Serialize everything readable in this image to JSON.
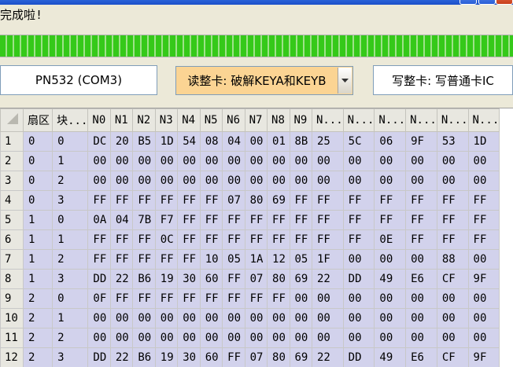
{
  "status_text": "完成啦!",
  "progress_percent": 100,
  "reader": {
    "label": "PN532 (COM3)"
  },
  "mode": {
    "selected": "读整卡: 破解KEYA和KEYB"
  },
  "write_button": {
    "label": "写整卡: 写普通卡IC"
  },
  "colors": {
    "progress": "#35c919",
    "combo_bg": "#fbd493",
    "cell_bg": "#d2d2ec"
  },
  "grid": {
    "columns": [
      "扇区",
      "块...",
      "N0",
      "N1",
      "N2",
      "N3",
      "N4",
      "N5",
      "N6",
      "N7",
      "N8",
      "N9",
      "N...",
      "N...",
      "N...",
      "N...",
      "N...",
      "N..."
    ],
    "rows": [
      {
        "n": "1",
        "cells": [
          "0",
          "0",
          "DC",
          "20",
          "B5",
          "1D",
          "54",
          "08",
          "04",
          "00",
          "01",
          "8B",
          "25",
          "5C",
          "06",
          "9F",
          "53",
          "1D"
        ]
      },
      {
        "n": "2",
        "cells": [
          "0",
          "1",
          "00",
          "00",
          "00",
          "00",
          "00",
          "00",
          "00",
          "00",
          "00",
          "00",
          "00",
          "00",
          "00",
          "00",
          "00",
          "00"
        ]
      },
      {
        "n": "3",
        "cells": [
          "0",
          "2",
          "00",
          "00",
          "00",
          "00",
          "00",
          "00",
          "00",
          "00",
          "00",
          "00",
          "00",
          "00",
          "00",
          "00",
          "00",
          "00"
        ]
      },
      {
        "n": "4",
        "cells": [
          "0",
          "3",
          "FF",
          "FF",
          "FF",
          "FF",
          "FF",
          "FF",
          "07",
          "80",
          "69",
          "FF",
          "FF",
          "FF",
          "FF",
          "FF",
          "FF",
          "FF"
        ]
      },
      {
        "n": "5",
        "cells": [
          "1",
          "0",
          "0A",
          "04",
          "7B",
          "F7",
          "FF",
          "FF",
          "FF",
          "FF",
          "FF",
          "FF",
          "FF",
          "FF",
          "FF",
          "FF",
          "FF",
          "FF"
        ]
      },
      {
        "n": "6",
        "cells": [
          "1",
          "1",
          "FF",
          "FF",
          "FF",
          "0C",
          "FF",
          "FF",
          "FF",
          "FF",
          "FF",
          "FF",
          "FF",
          "FF",
          "0E",
          "FF",
          "FF",
          "FF"
        ]
      },
      {
        "n": "7",
        "cells": [
          "1",
          "2",
          "FF",
          "FF",
          "FF",
          "FF",
          "FF",
          "10",
          "05",
          "1A",
          "12",
          "05",
          "1F",
          "00",
          "00",
          "00",
          "88",
          "00"
        ]
      },
      {
        "n": "8",
        "cells": [
          "1",
          "3",
          "DD",
          "22",
          "B6",
          "19",
          "30",
          "60",
          "FF",
          "07",
          "80",
          "69",
          "22",
          "DD",
          "49",
          "E6",
          "CF",
          "9F"
        ]
      },
      {
        "n": "9",
        "cells": [
          "2",
          "0",
          "0F",
          "FF",
          "FF",
          "FF",
          "FF",
          "FF",
          "FF",
          "FF",
          "FF",
          "00",
          "00",
          "00",
          "00",
          "00",
          "00",
          "00"
        ]
      },
      {
        "n": "10",
        "cells": [
          "2",
          "1",
          "00",
          "00",
          "00",
          "00",
          "00",
          "00",
          "00",
          "00",
          "00",
          "00",
          "00",
          "00",
          "00",
          "00",
          "00",
          "00"
        ]
      },
      {
        "n": "11",
        "cells": [
          "2",
          "2",
          "00",
          "00",
          "00",
          "00",
          "00",
          "00",
          "00",
          "00",
          "00",
          "00",
          "00",
          "00",
          "00",
          "00",
          "00",
          "00"
        ]
      },
      {
        "n": "12",
        "cells": [
          "2",
          "3",
          "DD",
          "22",
          "B6",
          "19",
          "30",
          "60",
          "FF",
          "07",
          "80",
          "69",
          "22",
          "DD",
          "49",
          "E6",
          "CF",
          "9F"
        ]
      }
    ]
  }
}
